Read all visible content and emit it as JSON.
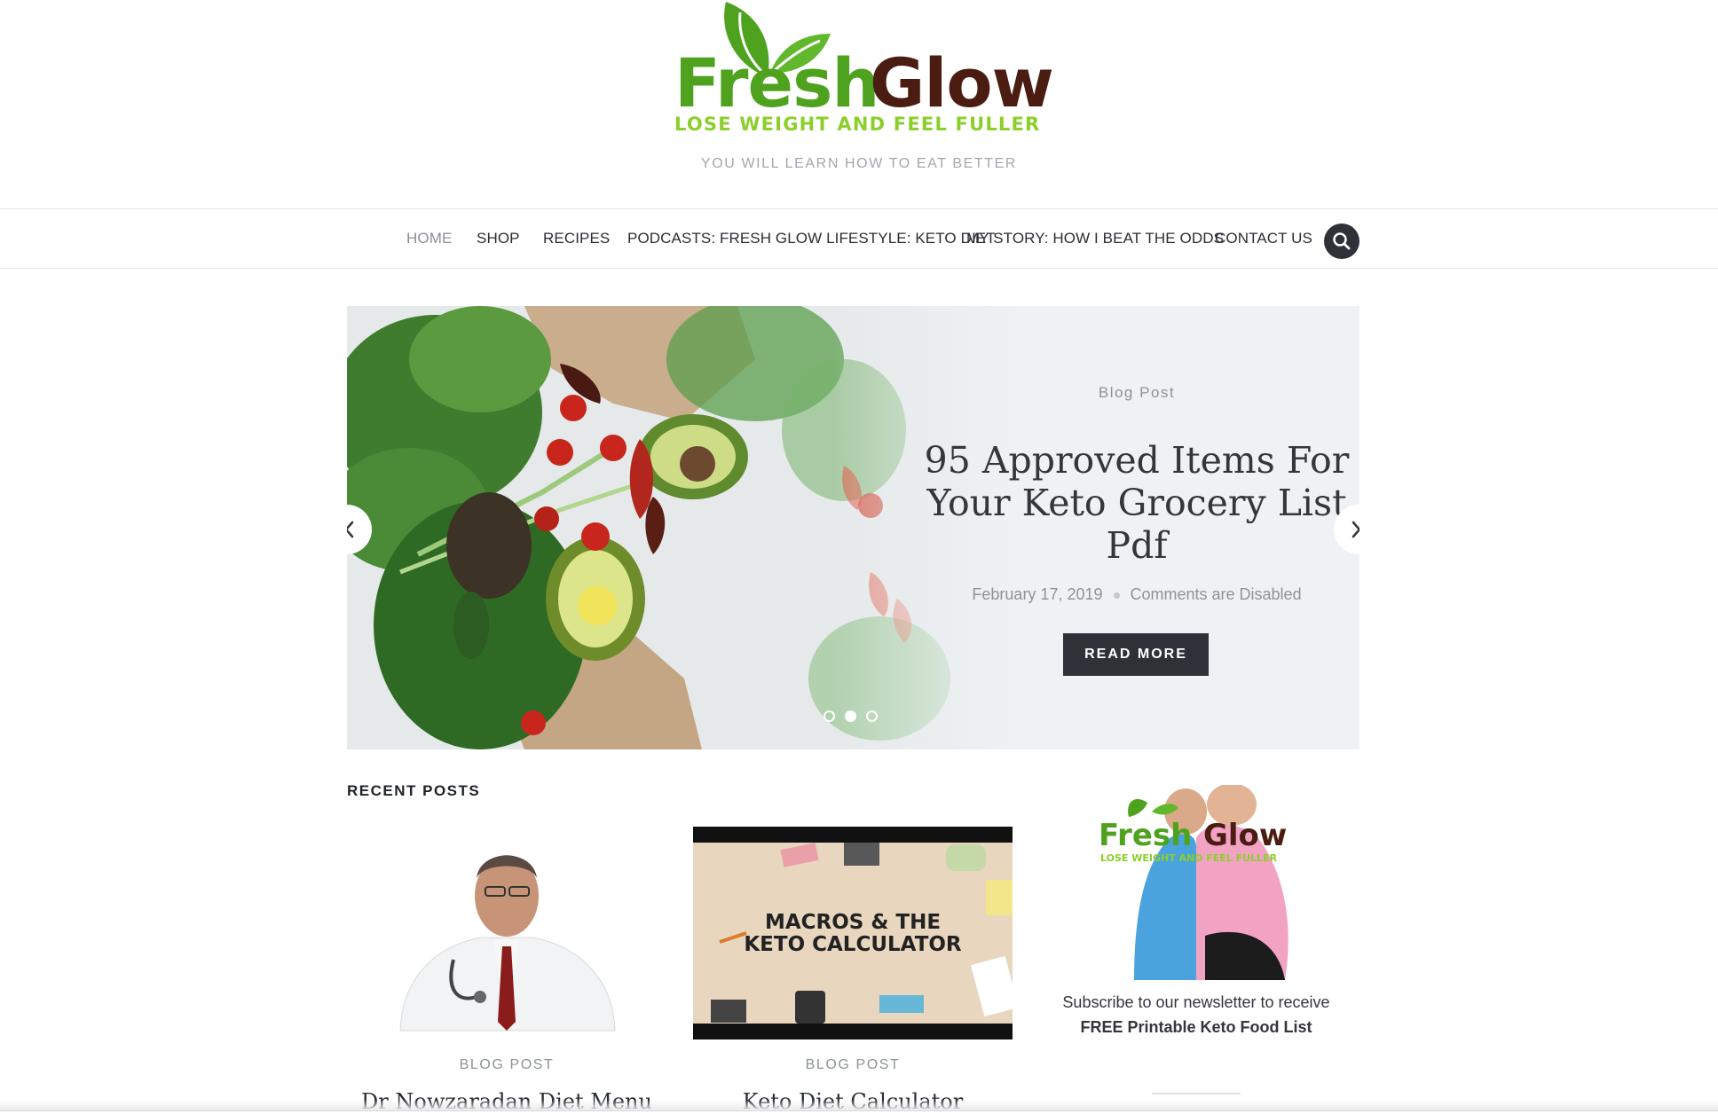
{
  "header": {
    "logo": {
      "word1": "Fresh",
      "word2": "Glow",
      "tagline": "LOSE WEIGHT AND FEEL FULLER"
    },
    "description": "YOU WILL LEARN HOW TO EAT BETTER"
  },
  "nav": {
    "items": [
      {
        "label": "HOME",
        "active": true
      },
      {
        "label": "SHOP"
      },
      {
        "label": "RECIPES"
      },
      {
        "label": "PODCASTS: FRESH GLOW LIFESTYLE: KETO DIET"
      },
      {
        "label": "MY STORY: HOW I BEAT THE ODDS"
      },
      {
        "label": "CONTACT US"
      }
    ],
    "search_icon": "search-icon"
  },
  "slider": {
    "category": "Blog Post",
    "title_lines": [
      "95 Approved Items For",
      "Your Keto Grocery List",
      "Pdf"
    ],
    "date": "February 17, 2019",
    "comments": "Comments are Disabled",
    "button": "READ MORE",
    "prev_icon": "chevron-left-icon",
    "next_icon": "chevron-right-icon",
    "dots": 3,
    "active_dot": 2
  },
  "recent": {
    "heading": "RECENT POSTS",
    "posts": [
      {
        "category": "BLOG POST",
        "title": "Dr Nowzaradan Diet Menu"
      },
      {
        "category": "BLOG POST",
        "title": "Keto Diet Calculator",
        "thumb_text_1": "MACROS & THE",
        "thumb_text_2": "KETO CALCULATOR"
      }
    ]
  },
  "widget": {
    "logo_word1": "Fresh",
    "logo_word2": "Glow",
    "logo_tagline": "LOSE WEIGHT AND FEEL FULLER",
    "text": "Subscribe to our newsletter to receive",
    "text_bold": "FREE Printable Keto Food List"
  },
  "colors": {
    "brand_green": "#4ea21e",
    "brand_brown": "#4a1c12",
    "brand_lime": "#8ccf2b",
    "dark": "#2e3138",
    "muted": "#8d9399"
  }
}
